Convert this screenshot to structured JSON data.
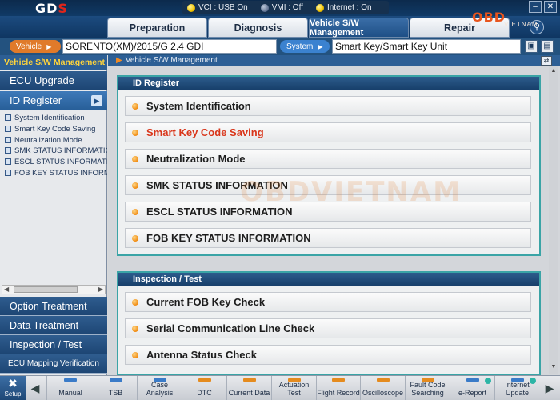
{
  "app": {
    "logo_main": "GD",
    "logo_accent": "S"
  },
  "status": {
    "vci": "VCI : USB On",
    "vmi": "VMI : Off",
    "internet": "Internet : On"
  },
  "window": {
    "minimize": "–",
    "close": "✕"
  },
  "tabs": [
    {
      "label": "Preparation"
    },
    {
      "label": "Diagnosis"
    },
    {
      "label": "Vehicle S/W Management",
      "active": true
    },
    {
      "label": "Repair"
    }
  ],
  "brand_watermark": {
    "big": "OBD",
    "small": "VIETNAM",
    "center": "OBDVIETNAM"
  },
  "vehicle_row": {
    "vehicle_label": "Vehicle",
    "vehicle_value": "SORENTO(XM)/2015/G 2.4 GDI",
    "system_label": "System",
    "system_value": "Smart Key/Smart Key Unit"
  },
  "sidebar": {
    "title": "Vehicle S/W Management",
    "main_items": [
      {
        "label": "ECU Upgrade"
      },
      {
        "label": "ID Register",
        "active": true
      }
    ],
    "sub_items": [
      "System Identification",
      "Smart Key Code Saving",
      "Neutralization Mode",
      "SMK STATUS INFORMATION",
      "ESCL STATUS INFORMATION",
      "FOB KEY STATUS INFORMATION"
    ],
    "bottom_items": [
      "Option Treatment",
      "Data Treatment",
      "Inspection / Test",
      "ECU Mapping Verification"
    ]
  },
  "content": {
    "breadcrumb": "Vehicle S/W Management",
    "panels": [
      {
        "title": "ID Register",
        "items": [
          {
            "label": "System Identification"
          },
          {
            "label": "Smart Key Code Saving",
            "highlight": true
          },
          {
            "label": "Neutralization Mode"
          },
          {
            "label": "SMK STATUS INFORMATION"
          },
          {
            "label": "ESCL STATUS INFORMATION"
          },
          {
            "label": "FOB KEY STATUS INFORMATION"
          }
        ]
      },
      {
        "title": "Inspection / Test",
        "items": [
          {
            "label": "Current FOB Key Check"
          },
          {
            "label": "Serial Communication Line Check"
          },
          {
            "label": "Antenna Status Check"
          }
        ]
      }
    ]
  },
  "toolbar": {
    "setup": "Setup",
    "buttons": [
      {
        "label": "Manual",
        "color": "#3a7bc8"
      },
      {
        "label": "TSB",
        "color": "#3a7bc8"
      },
      {
        "label": "Case Analysis",
        "color": "#3a7bc8"
      },
      {
        "label": "DTC",
        "color": "#e58b1e"
      },
      {
        "label": "Current Data",
        "color": "#e58b1e"
      },
      {
        "label": "Actuation Test",
        "color": "#e58b1e"
      },
      {
        "label": "Flight Record",
        "color": "#e58b1e"
      },
      {
        "label": "Oscilloscope",
        "color": "#e58b1e"
      },
      {
        "label": "Fault Code Searching",
        "color": "#e58b1e"
      },
      {
        "label": "e-Report",
        "color": "#3a7bc8",
        "badge": true
      },
      {
        "label": "Internet Update",
        "color": "#3a7bc8",
        "badge": true
      }
    ]
  }
}
